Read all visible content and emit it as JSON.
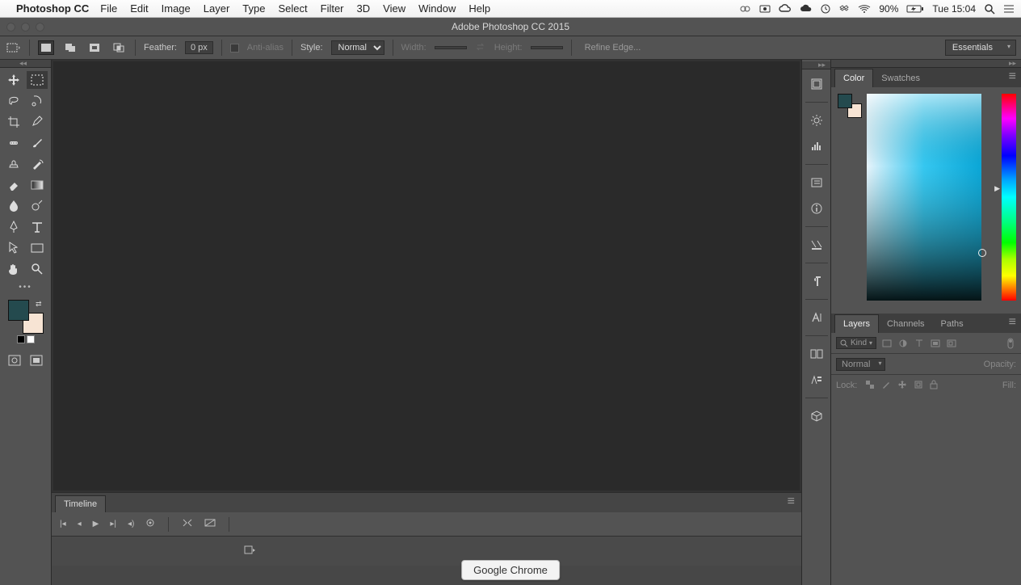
{
  "menubar": {
    "app_name": "Photoshop CC",
    "menus": [
      "File",
      "Edit",
      "Image",
      "Layer",
      "Type",
      "Select",
      "Filter",
      "3D",
      "View",
      "Window",
      "Help"
    ],
    "battery": "90%",
    "clock": "Tue 15:04"
  },
  "window": {
    "title": "Adobe Photoshop CC 2015"
  },
  "options": {
    "feather_label": "Feather:",
    "feather_value": "0 px",
    "antialias_label": "Anti-alias",
    "style_label": "Style:",
    "style_value": "Normal",
    "width_label": "Width:",
    "height_label": "Height:",
    "refine_label": "Refine Edge...",
    "workspace": "Essentials"
  },
  "panels": {
    "color_tabs": [
      "Color",
      "Swatches"
    ],
    "layers_tabs": [
      "Layers",
      "Channels",
      "Paths"
    ],
    "timeline_tab": "Timeline"
  },
  "layers": {
    "kind_label": "Kind",
    "blend_mode": "Normal",
    "opacity_label": "Opacity:",
    "lock_label": "Lock:",
    "fill_label": "Fill:"
  },
  "colors": {
    "foreground": "#244a4e",
    "background": "#f7e4d4"
  },
  "dock": {
    "tooltip": "Google Chrome"
  }
}
